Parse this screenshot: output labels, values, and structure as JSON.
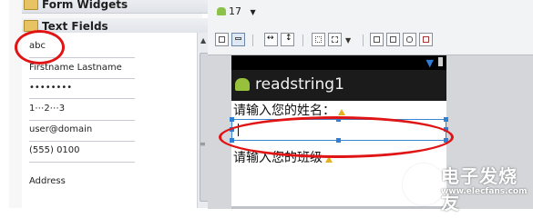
{
  "palette": {
    "category_top": "Form Widgets",
    "category_current": "Text Fields",
    "items": [
      "abc",
      "Firstname Lastname",
      "••••••••",
      "1⋯2⋯3",
      "user@domain",
      "(555) 0100",
      "Address"
    ]
  },
  "toolbar": {
    "api_level": "17"
  },
  "device": {
    "app_title": "readstring1",
    "prompt1": "请输入您的姓名：",
    "prompt2": "请输入您的班级"
  },
  "watermark": {
    "brand": "电子发烧友",
    "url": "www.elecfans.com"
  },
  "colors": {
    "highlight": "#e01414",
    "selection": "#2f80d3",
    "android_green": "#97c13c"
  },
  "icons": [
    "folder-icon",
    "android-icon",
    "chevron-down-icon",
    "layout-icon",
    "warning-icon",
    "battery-icon",
    "signal-icon"
  ]
}
